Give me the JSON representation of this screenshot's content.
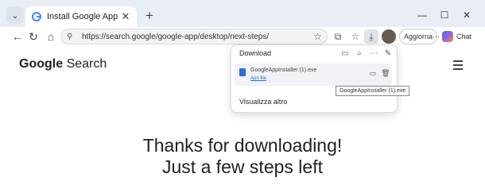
{
  "tab": {
    "title": "Install Google App"
  },
  "address_bar": {
    "url": "https://search.google/google-app/desktop/next-steps/"
  },
  "toolbar": {
    "update_label": "Aggiorna",
    "chat_label": "Chat"
  },
  "downloads_panel": {
    "title": "Download",
    "file_name": "GoogleAppInstaller (1).exe",
    "open_file_label": "Apri file",
    "see_more_label": "Visualizza altro"
  },
  "tooltip": {
    "text": "GoogleAppInstaller (1).exe"
  },
  "page": {
    "logo_brand": "Google",
    "logo_suffix": "Search",
    "headline_line1": "Thanks for downloading!",
    "headline_line2": "Just a few steps left"
  },
  "colors": {
    "accent": "#2b6cd9",
    "tabstrip": "#e9eef6",
    "text": "#202124"
  },
  "icons": [
    "tab-list-icon",
    "google-favicon",
    "close-icon",
    "plus-icon",
    "minimize-icon",
    "maximize-icon",
    "close-window-icon",
    "back-icon",
    "forward-icon",
    "refresh-icon",
    "home-icon",
    "site-info-icon",
    "star-icon",
    "extensions-icon",
    "favorites-icon",
    "download-icon",
    "avatar",
    "more-icon",
    "copilot-icon",
    "folder-icon",
    "search-icon",
    "pin-icon",
    "trash-icon",
    "file-icon",
    "hamburger-menu-icon"
  ]
}
